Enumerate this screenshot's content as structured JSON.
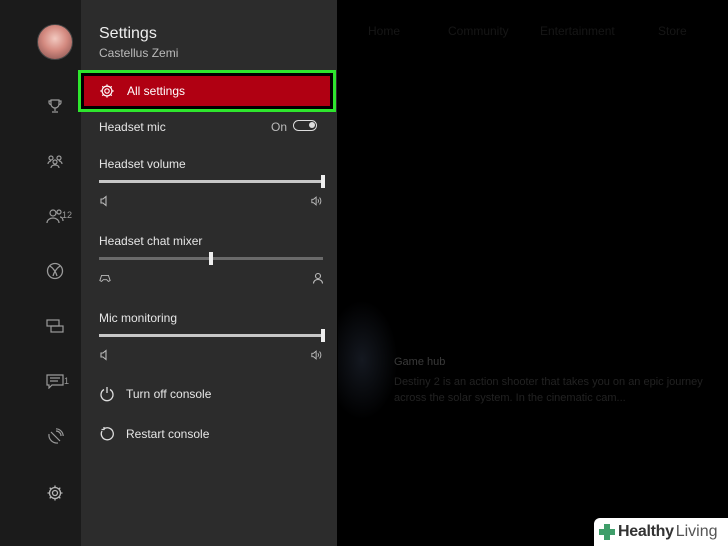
{
  "background": {
    "tabs": [
      "Home",
      "Community",
      "Entertainment",
      "Store"
    ],
    "hub_title": "Game hub",
    "hub_description": "Destiny 2 is an action shooter that takes you on an epic journey across the solar system. In the cinematic cam..."
  },
  "rail": {
    "items": [
      {
        "icon": "trophy-icon"
      },
      {
        "icon": "party-icon"
      },
      {
        "icon": "friends-icon",
        "badge": "12"
      },
      {
        "icon": "xbox-logo-icon"
      },
      {
        "icon": "messages-icon"
      },
      {
        "icon": "notifications-icon",
        "badge": "1"
      },
      {
        "icon": "broadcast-icon"
      },
      {
        "icon": "gear-icon"
      }
    ]
  },
  "settings": {
    "title": "Settings",
    "gamertag": "Castellus Zemi",
    "all_settings_label": "All settings",
    "headset_mic_label": "Headset mic",
    "headset_mic_state": "On",
    "headset_volume_label": "Headset volume",
    "headset_volume_level": 1.0,
    "chat_mixer_label": "Headset chat mixer",
    "chat_mixer_level": 0.5,
    "mic_monitoring_label": "Mic monitoring",
    "mic_monitoring_level": 1.0,
    "turn_off_label": "Turn off console",
    "restart_label": "Restart console"
  },
  "colors": {
    "highlight": "#b00012",
    "annotation_border": "#2ee62e"
  },
  "watermark": {
    "brand_bold": "Healthy",
    "brand_light": "Living"
  }
}
